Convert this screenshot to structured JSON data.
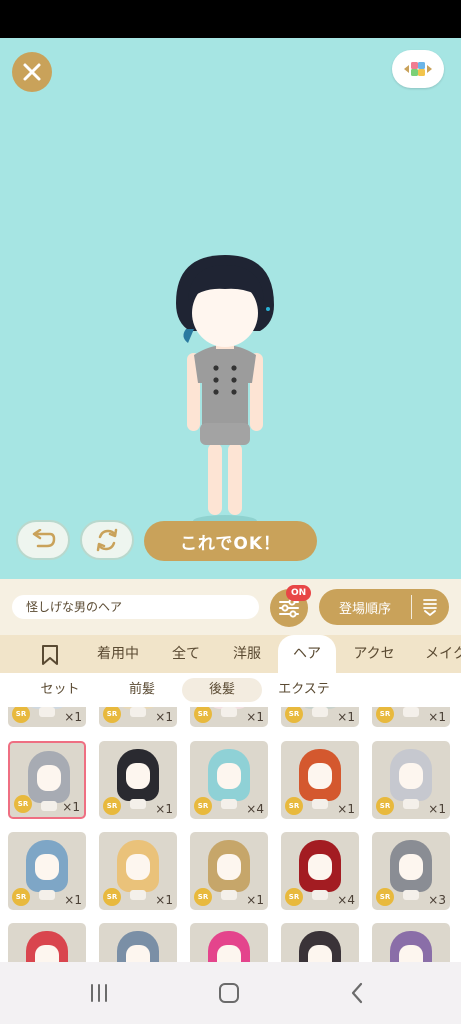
{
  "name_field": "怪しげな男のヘア",
  "filter_badge": "ON",
  "sort_label": "登場順序",
  "ok_button": "これでOK！",
  "category_tabs": [
    "着用中",
    "全て",
    "洋服",
    "ヘア",
    "アクセ",
    "メイク"
  ],
  "sub_tabs": [
    "セット",
    "前髪",
    "後髪",
    "エクステ"
  ],
  "rarity": "SR",
  "items": [
    {
      "count": "×1"
    },
    {
      "count": "×1"
    },
    {
      "count": "×1"
    },
    {
      "count": "×1"
    },
    {
      "count": "×1"
    },
    {
      "count": "×1"
    },
    {
      "count": "×1"
    },
    {
      "count": "×4"
    },
    {
      "count": "×1"
    },
    {
      "count": "×1"
    },
    {
      "count": "×1"
    },
    {
      "count": "×1"
    },
    {
      "count": "×1"
    },
    {
      "count": "×4"
    },
    {
      "count": "×3"
    }
  ],
  "colors": {
    "stage": "#a6e5e3",
    "accent": "#c9a25a",
    "badge": "#e84646"
  }
}
